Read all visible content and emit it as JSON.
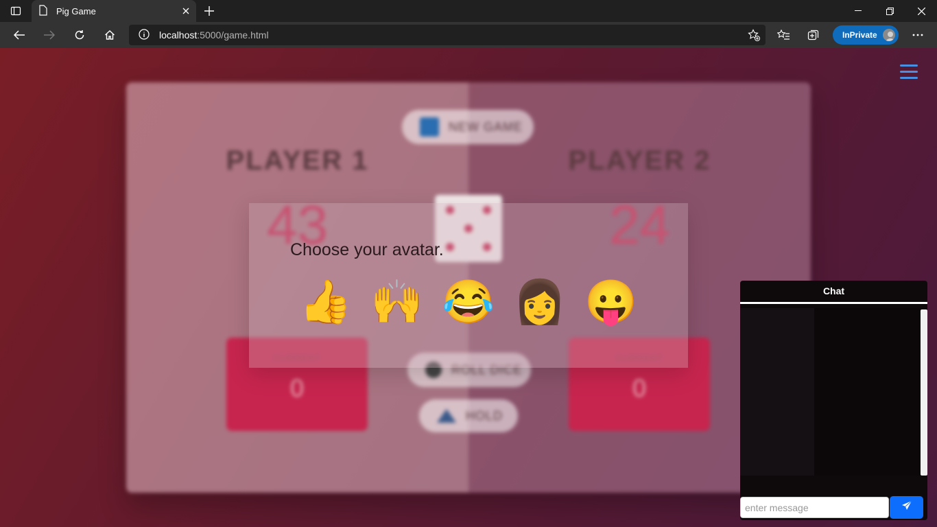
{
  "browser": {
    "tab_title": "Pig Game",
    "address_host": "localhost",
    "address_path": ":5000/game.html",
    "inprivate_label": "InPrivate"
  },
  "game": {
    "new_game_label": "NEW GAME",
    "roll_label": "ROLL DICE",
    "hold_label": "HOLD",
    "players": [
      {
        "name": "PLAYER 1",
        "score": "43",
        "current_label": "CURRENT",
        "current": "0"
      },
      {
        "name": "PLAYER 2",
        "score": "24",
        "current_label": "CURRENT",
        "current": "0"
      }
    ],
    "dice_value": 5
  },
  "modal": {
    "title": "Choose your avatar.",
    "avatars": [
      "👍",
      "🙌",
      "😂",
      "👩",
      "😛"
    ]
  },
  "chat": {
    "title": "Chat",
    "input_placeholder": "enter message"
  },
  "colors": {
    "accent": "#c7254e",
    "send_button": "#0d6efd",
    "menu_icon": "#4a90e2"
  }
}
